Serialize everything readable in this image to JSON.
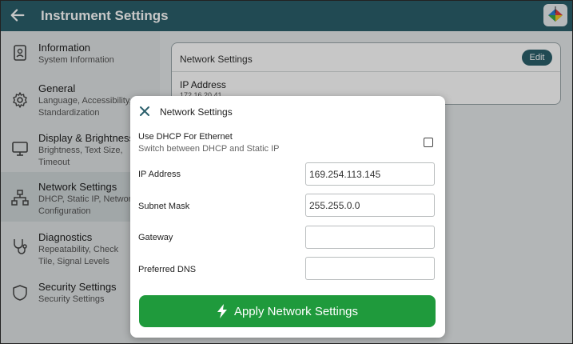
{
  "header": {
    "title": "Instrument Settings"
  },
  "sidebar": {
    "items": [
      {
        "title": "Information",
        "subtitle": [
          "System Information"
        ]
      },
      {
        "title": "General",
        "subtitle": [
          "Language, Accessibility,",
          "Standardization"
        ]
      },
      {
        "title": "Display & Brightness",
        "subtitle": [
          "Brightness, Text Size,",
          "Timeout"
        ]
      },
      {
        "title": "Network Settings",
        "subtitle": [
          "DHCP, Static IP, Network",
          "Configuration"
        ]
      },
      {
        "title": "Diagnostics",
        "subtitle": [
          "Repeatability, Check",
          "Tile, Signal Levels"
        ]
      },
      {
        "title": "Security Settings",
        "subtitle": [
          "Security Settings"
        ]
      }
    ]
  },
  "card": {
    "title": "Network Settings",
    "edit_label": "Edit",
    "ip_label": "IP Address",
    "ip_value": "172.16.20.41"
  },
  "modal": {
    "title": "Network Settings",
    "dhcp_label": "Use DHCP For Ethernet",
    "dhcp_sub": "Switch between DHCP and Static IP",
    "dhcp_checked": false,
    "fields": [
      {
        "label": "IP Address",
        "value": "169.254.113.145"
      },
      {
        "label": "Subnet Mask",
        "value": "255.255.0.0"
      },
      {
        "label": "Gateway",
        "value": ""
      },
      {
        "label": "Preferred DNS",
        "value": ""
      }
    ],
    "apply_label": "Apply Network Settings"
  },
  "colors": {
    "header": "#2b5f6b",
    "apply": "#1f9a3c"
  }
}
